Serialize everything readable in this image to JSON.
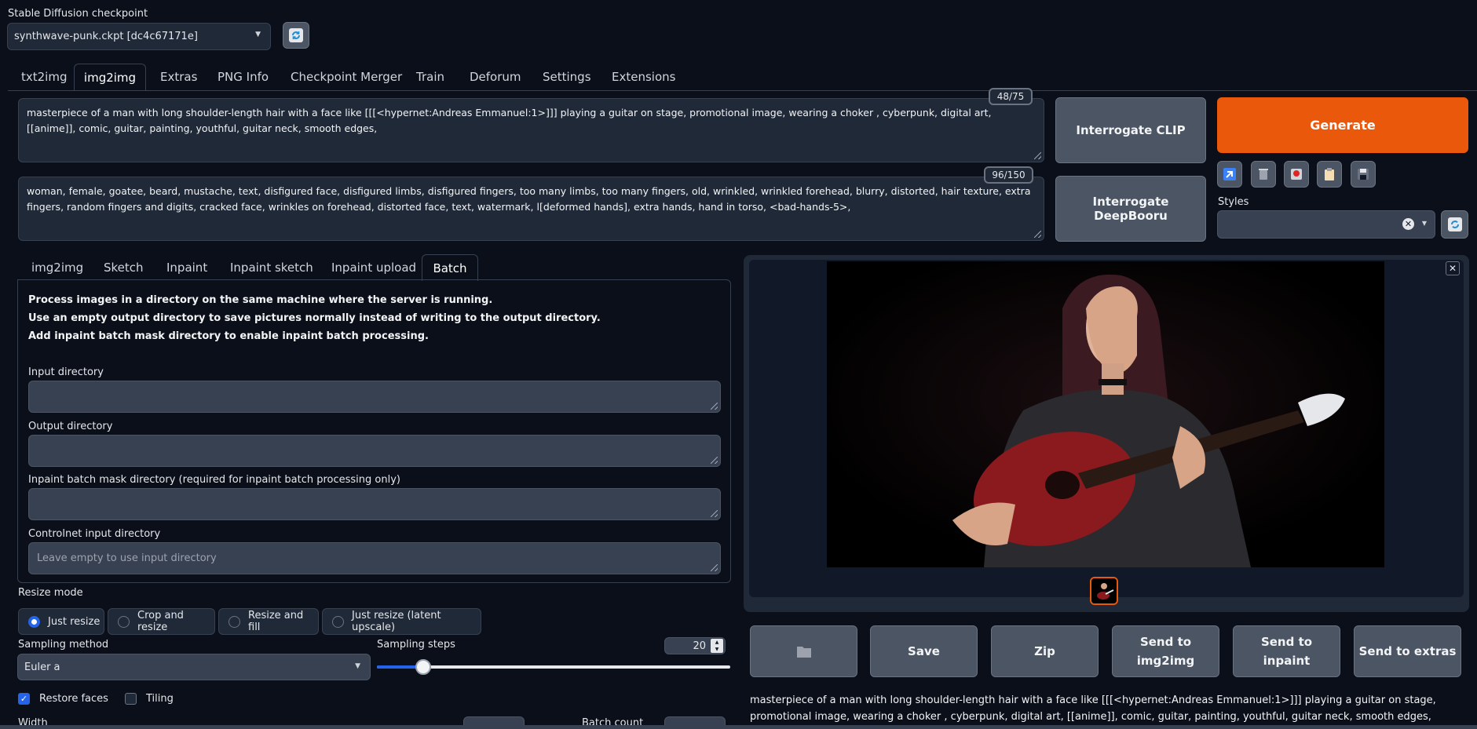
{
  "checkpoint": {
    "label": "Stable Diffusion checkpoint",
    "selected": "synthwave-punk.ckpt [dc4c67171e]"
  },
  "main_tabs": [
    "txt2img",
    "img2img",
    "Extras",
    "PNG Info",
    "Checkpoint Merger",
    "Train",
    "Deforum",
    "Settings",
    "Extensions"
  ],
  "prompt": {
    "positive": "masterpiece of a man with long shoulder-length hair with a face like  [[[<hypernet:Andreas Emmanuel:1>]]] playing a guitar on stage, promotional image, wearing a choker , cyberpunk, digital art, [[anime]], comic, guitar, painting, youthful, guitar neck, smooth edges,",
    "positive_count": "48/75",
    "negative": "woman, female, goatee, beard, mustache, text, disfigured face, disfigured limbs, disfigured fingers, too many limbs, too many fingers, old, wrinkled, wrinkled forehead, blurry, distorted, hair texture, extra fingers, random fingers and digits, cracked face, wrinkles on forehead, distorted face, text, watermark, l[deformed hands], extra hands, hand in torso, <bad-hands-5>,",
    "negative_count": "96/150"
  },
  "buttons": {
    "interrogate_clip": "Interrogate CLIP",
    "interrogate_deepbooru": "Interrogate DeepBooru",
    "generate": "Generate"
  },
  "styles": {
    "label": "Styles",
    "value": ""
  },
  "sub_tabs": [
    "img2img",
    "Sketch",
    "Inpaint",
    "Inpaint sketch",
    "Inpaint upload",
    "Batch"
  ],
  "batch": {
    "info_1": "Process images in a directory on the same machine where the server is running.",
    "info_2": "Use an empty output directory to save pictures normally instead of writing to the output directory.",
    "info_3": "Add inpaint batch mask directory to enable inpaint batch processing.",
    "input_dir_label": "Input directory",
    "output_dir_label": "Output directory",
    "mask_dir_label": "Inpaint batch mask directory (required for inpaint batch processing only)",
    "controlnet_label": "Controlnet input directory",
    "controlnet_placeholder": "Leave empty to use input directory"
  },
  "resize_mode": {
    "label": "Resize mode",
    "options": [
      "Just resize",
      "Crop and resize",
      "Resize and fill",
      "Just resize (latent upscale)"
    ],
    "selected": "Just resize"
  },
  "sampling": {
    "method_label": "Sampling method",
    "method": "Euler a",
    "steps_label": "Sampling steps",
    "steps": "20",
    "steps_fraction": 0.13
  },
  "checks": {
    "restore_faces": "Restore faces",
    "restore_faces_checked": true,
    "tiling": "Tiling",
    "tiling_checked": false
  },
  "partial": {
    "width_label": "Width",
    "batch_count_label": "Batch count"
  },
  "output_buttons": {
    "save": "Save",
    "zip": "Zip",
    "send_img2img": "Send to img2img",
    "send_inpaint": "Send to inpaint",
    "send_extras": "Send to extras"
  },
  "output_caption": "masterpiece of a man with long shoulder-length hair with a face like [[[<hypernet:Andreas Emmanuel:1>]]] playing a guitar on stage, promotional image, wearing a choker , cyberpunk, digital art, [[anime]], comic, guitar, painting, youthful, guitar neck, smooth edges,",
  "colors": {
    "accent": "#ea580c",
    "bg": "#0b0f19",
    "panel": "#1f2937",
    "button": "#4b5563",
    "check": "#2563eb"
  }
}
